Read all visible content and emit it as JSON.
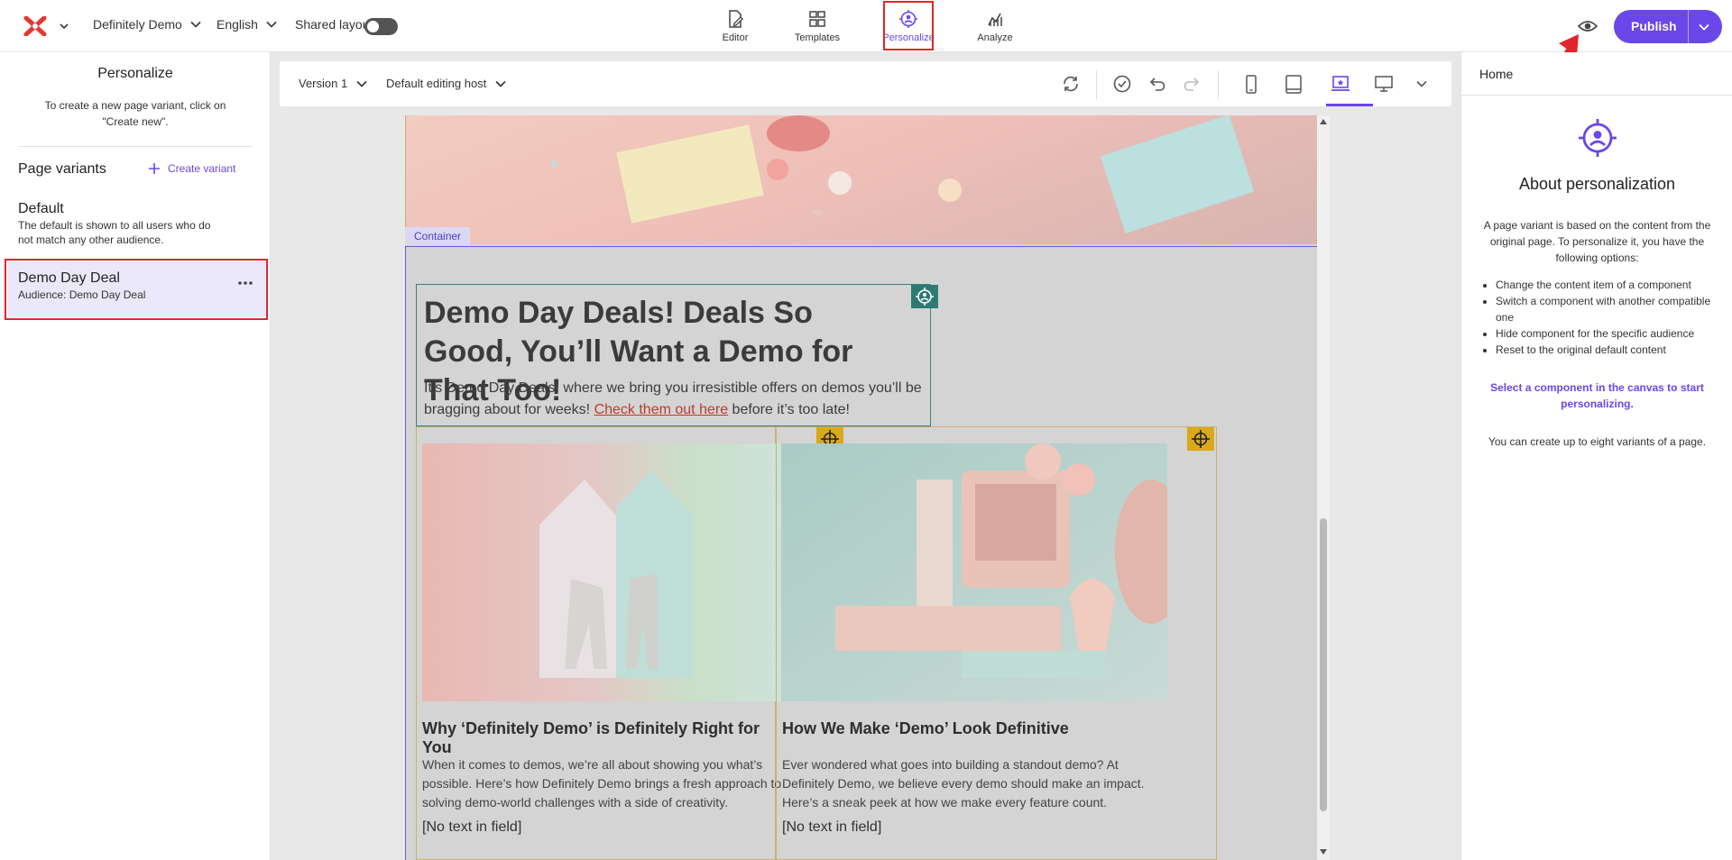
{
  "topbar": {
    "site_name": "Definitely Demo",
    "language": "English",
    "shared_layout_label": "Shared layout",
    "nav": [
      {
        "label": "Editor"
      },
      {
        "label": "Templates"
      },
      {
        "label": "Personalize"
      },
      {
        "label": "Analyze"
      }
    ],
    "publish_label": "Publish"
  },
  "left_panel": {
    "title": "Personalize",
    "description": "To create a new page variant, click on \"Create new\".",
    "section_title": "Page variants",
    "create_label": "Create variant",
    "variants": [
      {
        "name": "Default",
        "subtitle": "The default is shown to all users who do not match any other audience."
      },
      {
        "name": "Demo Day Deal",
        "subtitle": "Audience: Demo Day Deal"
      }
    ]
  },
  "canvas": {
    "version_label": "Version 1",
    "host_label": "Default editing host",
    "container_label": "Container",
    "hero": {
      "heading": "Demo Day Deals! Deals So Good, You’ll Want a Demo for That Too!",
      "text_before": "It’s Demo Day Deals, where we bring you irresistible offers on demos you’ll be bragging about for weeks! ",
      "link_text": "Check them out here",
      "text_after": " before it’s too late!"
    },
    "cards": [
      {
        "title": "Why ‘Definitely Demo’ is Definitely Right for You",
        "body": "When it comes to demos, we’re all about showing you what’s possible. Here’s how Definitely Demo brings a fresh approach to solving demo-world challenges with a side of creativity.",
        "placeholder": "[No text in field]"
      },
      {
        "title": "How We Make ‘Demo’ Look Definitive",
        "body": "Ever wondered what goes into building a standout demo? At Definitely Demo, we believe every demo should make an impact. Here’s a sneak peek at how we make every feature count.",
        "placeholder": "[No text in field]"
      }
    ]
  },
  "right_panel": {
    "header": "Home",
    "title": "About personalization",
    "description": "A page variant is based on the content from the original page. To personalize it, you have the following options:",
    "options": [
      "Change the content item of a component",
      "Switch a component with another compatible one",
      "Hide component for the specific audience",
      "Reset to the original default content"
    ],
    "cta": "Select a component in the canvas to start personalizing.",
    "note": "You can create up to eight variants of a page."
  },
  "colors": {
    "accent": "#6b46e8",
    "highlight_red": "#e1252b",
    "teal_pin": "#2d7a74",
    "gold_pin": "#d9a918"
  }
}
